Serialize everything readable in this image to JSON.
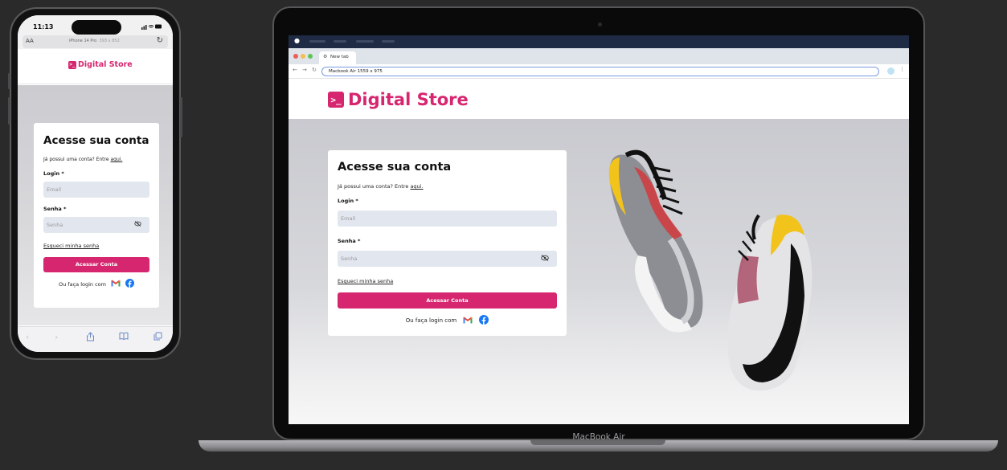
{
  "brand": {
    "name": "Digital Store",
    "color": "#d6266f",
    "icon": "terminal-prompt-icon"
  },
  "login": {
    "title": "Acesse sua conta",
    "subtitle_prefix": "Já possui uma conta? Entre ",
    "subtitle_link": "aqui.",
    "login_label": "Login *",
    "email_placeholder": "Email",
    "password_label": "Senha *",
    "password_placeholder": "Senha",
    "forgot_password": "Esqueci minha senha",
    "submit_button": "Acessar Conta",
    "social_prefix": "Ou faça login com",
    "social_icons": [
      "gmail-icon",
      "facebook-icon"
    ]
  },
  "phone": {
    "time": "11:13",
    "url_device": "iPhone 14 Pro",
    "url_size": "393 x 852",
    "aa_label": "AA"
  },
  "laptop": {
    "tab_title": "New tab",
    "address": "Macbook Air  1559 x 975",
    "device_label": "MacBook Air"
  }
}
